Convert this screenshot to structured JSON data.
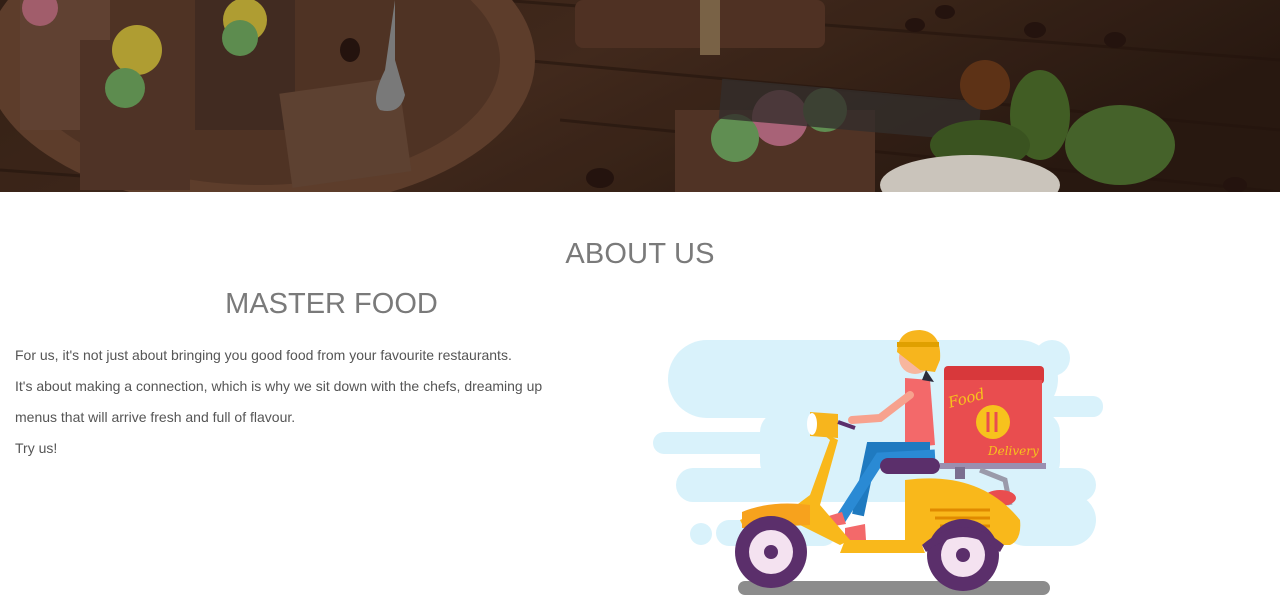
{
  "hero": {
    "image": "dessert-cakes-on-wooden-table-photo"
  },
  "about": {
    "section_title": "ABOUT US",
    "sub_title": "MASTER FOOD",
    "paragraphs": [
      "For us, it's not just about bringing you good food from your favourite restaurants.",
      "It's about making a connection, which is why we sit down with the chefs, dreaming up",
      "menus that will arrive fresh and full of flavour.",
      "Try us!"
    ]
  },
  "illustration": {
    "box_text_line1": "Food",
    "box_text_line2": "Delivery",
    "colors": {
      "scooter": "#f9b81b",
      "box": "#e94d4f",
      "cloud": "#d9f2fb",
      "helmet": "#f7b51d",
      "wheel": "#5b2f6b"
    }
  }
}
